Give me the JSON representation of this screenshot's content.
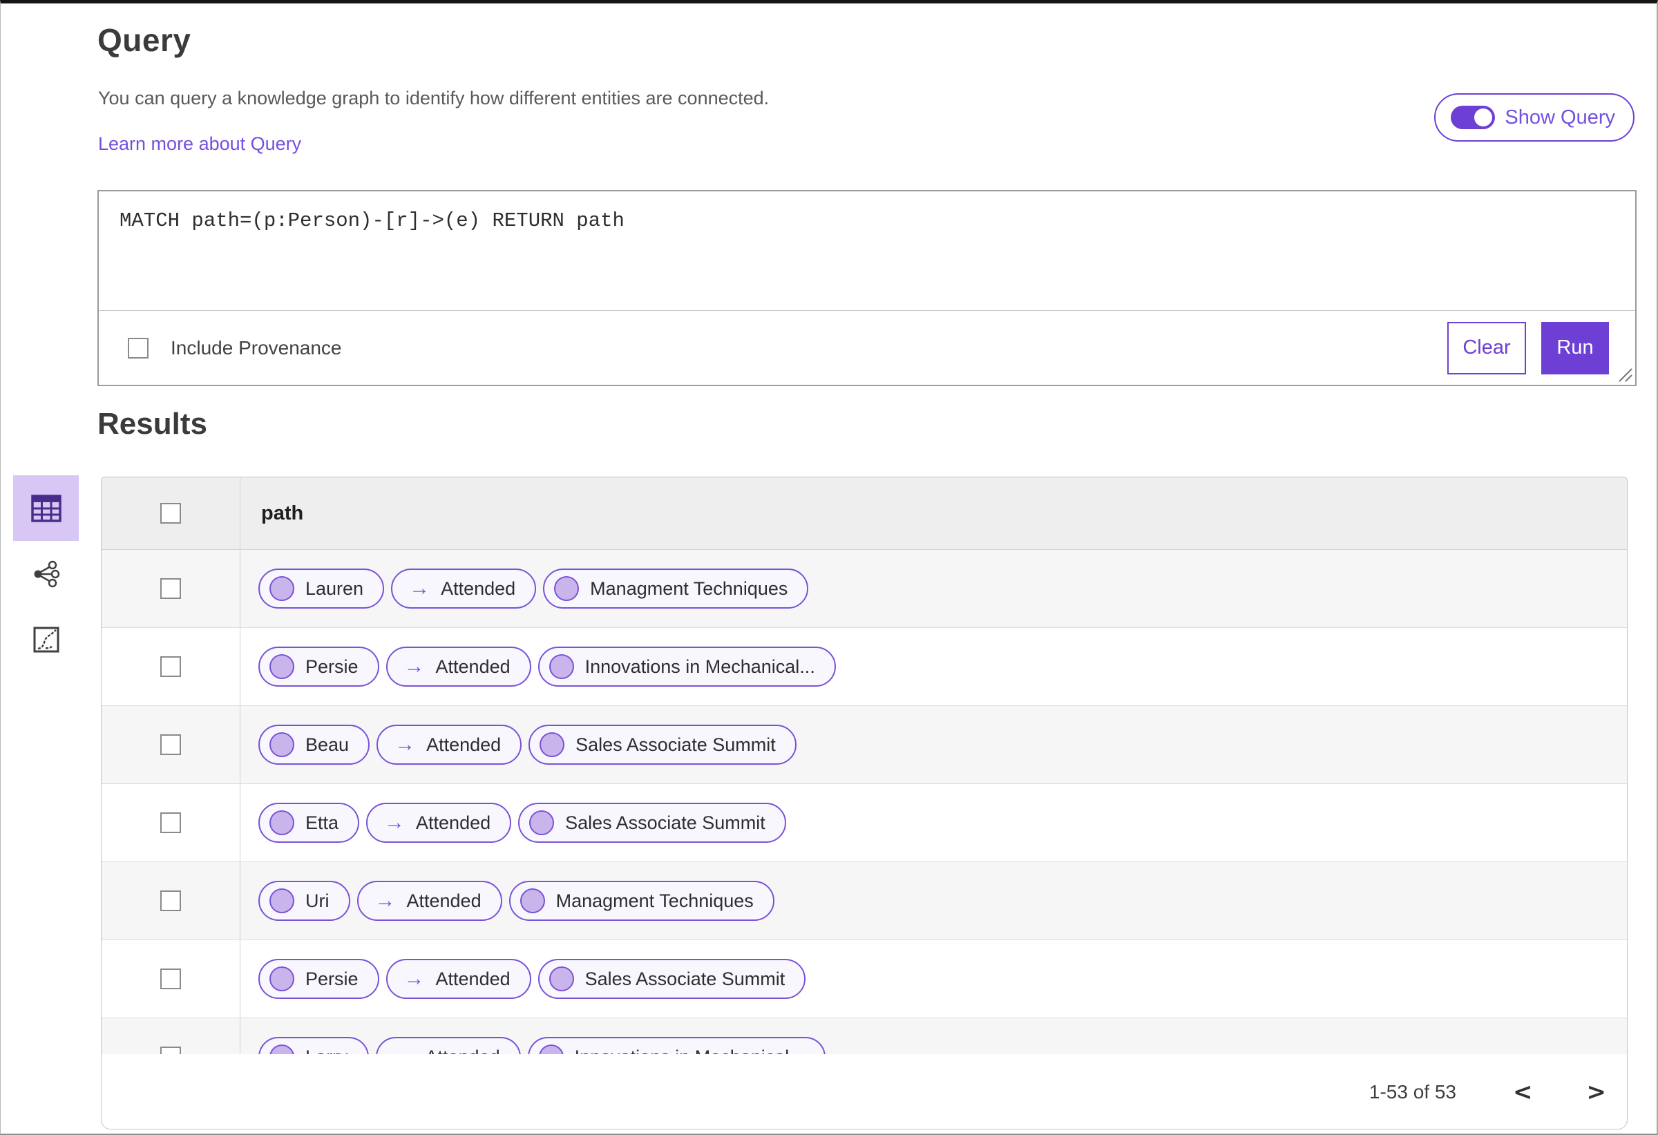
{
  "header": {
    "title": "Query",
    "description": "You can query a knowledge graph to identify how different entities are connected.",
    "learn_more_link": "Learn more about Query",
    "show_query_toggle": {
      "label": "Show Query",
      "state": "on"
    }
  },
  "query_editor": {
    "query_text": "MATCH path=(p:Person)-[r]->(e) RETURN path",
    "include_provenance": {
      "label": "Include Provenance",
      "checked": false
    },
    "buttons": {
      "clear": "Clear",
      "run": "Run"
    }
  },
  "results": {
    "heading": "Results",
    "view_switcher": [
      {
        "name": "table-view",
        "selected": true
      },
      {
        "name": "graph-view",
        "selected": false
      },
      {
        "name": "chart-view",
        "selected": false
      }
    ],
    "table": {
      "select_all_checked": false,
      "columns": [
        "path"
      ],
      "edge_arrow": "→",
      "rows": [
        {
          "source": "Lauren",
          "edge": "Attended",
          "target": "Managment Techniques",
          "checked": false
        },
        {
          "source": "Persie",
          "edge": "Attended",
          "target": "Innovations in Mechanical...",
          "checked": false
        },
        {
          "source": "Beau",
          "edge": "Attended",
          "target": "Sales Associate Summit",
          "checked": false
        },
        {
          "source": "Etta",
          "edge": "Attended",
          "target": "Sales Associate Summit",
          "checked": false
        },
        {
          "source": "Uri",
          "edge": "Attended",
          "target": "Managment Techniques",
          "checked": false
        },
        {
          "source": "Persie",
          "edge": "Attended",
          "target": "Sales Associate Summit",
          "checked": false
        },
        {
          "source": "Larry",
          "edge": "Attended",
          "target": "Innovations in Mechanical...",
          "checked": false
        }
      ]
    },
    "pagination": {
      "range_label": "1-53 of 53",
      "prev_icon": "<",
      "next_icon": ">"
    }
  },
  "colors": {
    "accent_purple": "#6d3fd4",
    "pill_border": "#7a52d8",
    "node_fill": "#c9b5ec",
    "link_purple": "#7450e0",
    "selected_view_bg": "#d8c7f5",
    "table_header_bg": "#eeeeef",
    "alt_row_bg": "#f6f6f7"
  }
}
